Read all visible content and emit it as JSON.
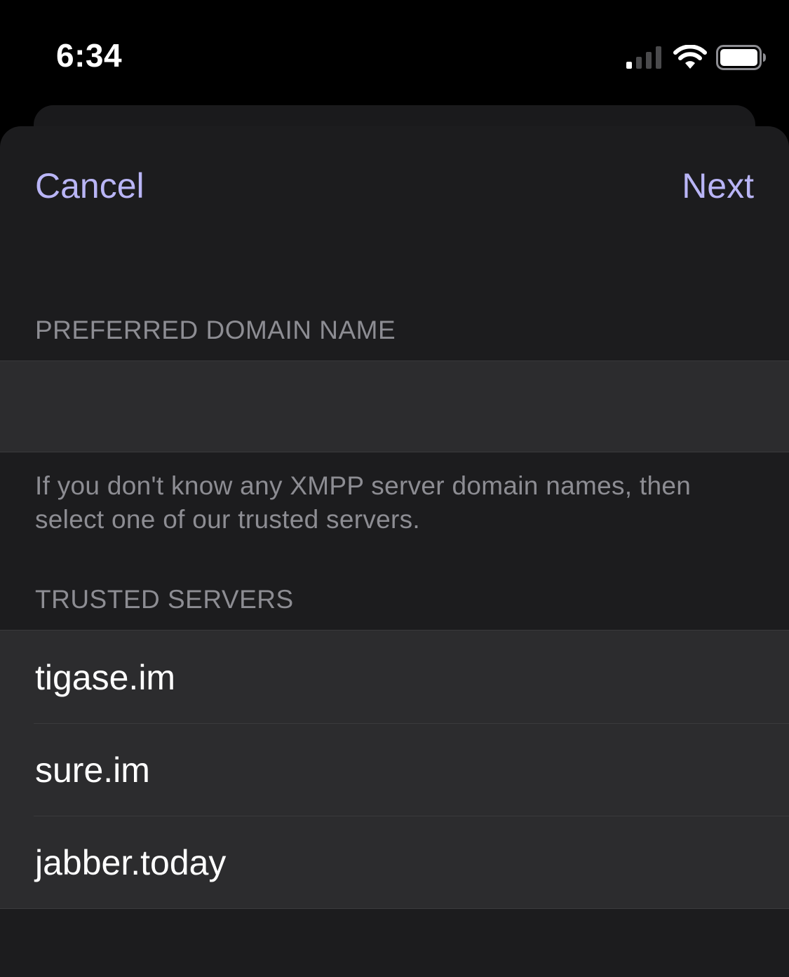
{
  "status_bar": {
    "time": "6:34",
    "icons": [
      "signal-icon",
      "wifi-icon",
      "battery-icon"
    ],
    "signal_level": 0.25,
    "battery_level": 1.0
  },
  "nav": {
    "cancel_label": "Cancel",
    "next_label": "Next"
  },
  "domain_section": {
    "header": "PREFERRED DOMAIN NAME",
    "input_value": "",
    "input_placeholder": "",
    "footer": "If you don't know any XMPP server domain names, then select one of our trusted servers."
  },
  "trusted_section": {
    "header": "TRUSTED SERVERS",
    "servers": [
      {
        "label": "tigase.im"
      },
      {
        "label": "sure.im"
      },
      {
        "label": "jabber.today"
      }
    ]
  },
  "colors": {
    "accent": "#b9b5f6",
    "background": "#000000",
    "sheet": "#1c1c1e",
    "cell": "#2c2c2e",
    "secondary_text": "#8d8d93",
    "separator": "#3a3a3c"
  }
}
